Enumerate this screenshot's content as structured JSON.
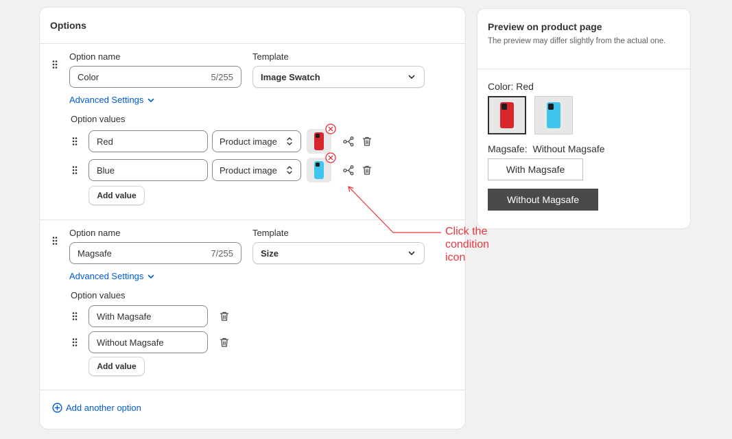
{
  "options_card": {
    "title": "Options",
    "add_another_option": "Add another option",
    "options": [
      {
        "name_label": "Option name",
        "template_label": "Template",
        "name_value": "Color",
        "name_count": "5/255",
        "template_value": "Image Swatch",
        "advanced_settings": "Advanced Settings",
        "values_label": "Option values",
        "values": [
          {
            "value": "Red",
            "source": "Product image",
            "swatch_color": "#d8262c"
          },
          {
            "value": "Blue",
            "source": "Product image",
            "swatch_color": "#3fc6ee"
          }
        ],
        "add_value": "Add value"
      },
      {
        "name_label": "Option name",
        "template_label": "Template",
        "name_value": "Magsafe",
        "name_count": "7/255",
        "template_value": "Size",
        "advanced_settings": "Advanced Settings",
        "values_label": "Option values",
        "values": [
          {
            "value": "With Magsafe"
          },
          {
            "value": "Without Magsafe"
          }
        ],
        "add_value": "Add value"
      }
    ]
  },
  "preview": {
    "title": "Preview on product page",
    "subtitle": "The preview may differ slightly from the actual one.",
    "color_label": "Color: Red",
    "magsafe_label": "Magsafe:",
    "magsafe_selected": "Without Magsafe",
    "buttons": [
      "With Magsafe",
      "Without Magsafe"
    ],
    "swatches": [
      "#d8262c",
      "#3fc6ee"
    ]
  },
  "annotation": {
    "text": "Click the condition icon",
    "lines": [
      "Click the",
      "condition",
      "icon"
    ],
    "color": "#e8363d"
  },
  "colors": {
    "accent_link": "#005bd3",
    "selected_button": "#4a4a4a"
  },
  "icons": [
    "drag-handle-icon",
    "chevron-down-icon",
    "select-arrows-icon",
    "remove-circle-icon",
    "condition-icon",
    "trash-icon",
    "plus-circle-icon"
  ]
}
